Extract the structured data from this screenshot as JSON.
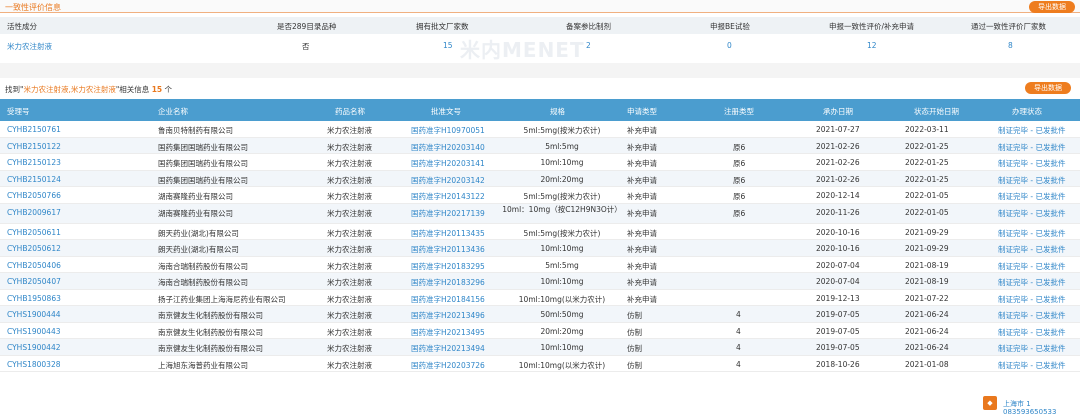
{
  "section_title": "一致性评价信息",
  "export_label": "导出数据",
  "summary": {
    "headers": [
      "活性成分",
      "是否289目录品种",
      "拥有批文厂家数",
      "备案参比制剂",
      "申报BE试验",
      "申报一致性评价/补充申请",
      "通过一致性评价厂家数"
    ],
    "row": [
      "米力农注射液",
      "否",
      "15",
      "2",
      "0",
      "12",
      "8"
    ]
  },
  "watermark": "米内MENET",
  "found": {
    "prefix": "找到\"",
    "keyword": "米力农注射液,米力农注射液",
    "mid": "\"相关信息",
    "count": "15",
    "suffix": "个"
  },
  "table": {
    "headers": [
      "受理号",
      "企业名称",
      "药品名称",
      "批准文号",
      "规格",
      "申请类型",
      "注册类型",
      "承办日期",
      "状态开始日期",
      "办理状态"
    ],
    "rows": [
      [
        "CYHB2150761",
        "鲁南贝特制药有限公司",
        "米力农注射液",
        "国药准字H10970051",
        "5ml:5mg(按米力农计)",
        "补充申请",
        "",
        "2021-07-27",
        "2022-03-11",
        "制证完毕 - 已发批件"
      ],
      [
        "CYHB2150122",
        "国药集团国瑞药业有限公司",
        "米力农注射液",
        "国药准字H20203140",
        "5ml:5mg",
        "补充申请",
        "原6",
        "2021-02-26",
        "2022-01-25",
        "制证完毕 - 已发批件"
      ],
      [
        "CYHB2150123",
        "国药集团国瑞药业有限公司",
        "米力农注射液",
        "国药准字H20203141",
        "10ml:10mg",
        "补充申请",
        "原6",
        "2021-02-26",
        "2022-01-25",
        "制证完毕 - 已发批件"
      ],
      [
        "CYHB2150124",
        "国药集团国瑞药业有限公司",
        "米力农注射液",
        "国药准字H20203142",
        "20ml:20mg",
        "补充申请",
        "原6",
        "2021-02-26",
        "2022-01-25",
        "制证完毕 - 已发批件"
      ],
      [
        "CYHB2050766",
        "湖南赛隆药业有限公司",
        "米力农注射液",
        "国药准字H20143122",
        "5ml:5mg(按米力农计)",
        "补充申请",
        "原6",
        "2020-12-14",
        "2022-01-05",
        "制证完毕 - 已发批件"
      ],
      [
        "CYHB2009617",
        "湖南赛隆药业有限公司",
        "米力农注射液",
        "国药准字H20217139",
        "10ml：10mg（按C12H9N3O计）",
        "补充申请",
        "原6",
        "2020-11-26",
        "2022-01-05",
        "制证完毕 - 已发批件"
      ],
      [
        "CYHB2050611",
        "朗天药业(湖北)有限公司",
        "米力农注射液",
        "国药准字H20113435",
        "5ml:5mg(按米力农计)",
        "补充申请",
        "",
        "2020-10-16",
        "2021-09-29",
        "制证完毕 - 已发批件"
      ],
      [
        "CYHB2050612",
        "朗天药业(湖北)有限公司",
        "米力农注射液",
        "国药准字H20113436",
        "10ml:10mg",
        "补充申请",
        "",
        "2020-10-16",
        "2021-09-29",
        "制证完毕 - 已发批件"
      ],
      [
        "CYHB2050406",
        "海南合瑞制药股份有限公司",
        "米力农注射液",
        "国药准字H20183295",
        "5ml:5mg",
        "补充申请",
        "",
        "2020-07-04",
        "2021-08-19",
        "制证完毕 - 已发批件"
      ],
      [
        "CYHB2050407",
        "海南合瑞制药股份有限公司",
        "米力农注射液",
        "国药准字H20183296",
        "10ml:10mg",
        "补充申请",
        "",
        "2020-07-04",
        "2021-08-19",
        "制证完毕 - 已发批件"
      ],
      [
        "CYHB1950863",
        "扬子江药业集团上海海尼药业有限公司",
        "米力农注射液",
        "国药准字H20184156",
        "10ml:10mg(以米力农计)",
        "补充申请",
        "",
        "2019-12-13",
        "2021-07-22",
        "制证完毕 - 已发批件"
      ],
      [
        "CYHS1900444",
        "南京健友生化制药股份有限公司",
        "米力农注射液",
        "国药准字H20213496",
        "50ml:50mg",
        "仿制",
        "4",
        "2019-07-05",
        "2021-06-24",
        "制证完毕 - 已发批件"
      ],
      [
        "CYHS1900443",
        "南京健友生化制药股份有限公司",
        "米力农注射液",
        "国药准字H20213495",
        "20ml:20mg",
        "仿制",
        "4",
        "2019-07-05",
        "2021-06-24",
        "制证完毕 - 已发批件"
      ],
      [
        "CYHS1900442",
        "南京健友生化制药股份有限公司",
        "米力农注射液",
        "国药准字H20213494",
        "10ml:10mg",
        "仿制",
        "4",
        "2019-07-05",
        "2021-06-24",
        "制证完毕 - 已发批件"
      ],
      [
        "CYHS1800328",
        "上海旭东海普药业有限公司",
        "米力农注射液",
        "国药准字H20203726",
        "10ml:10mg(以米力农计)",
        "仿制",
        "4",
        "2018-10-26",
        "2021-01-08",
        "制证完毕 - 已发批件"
      ]
    ]
  },
  "footer": {
    "line1": "上海市 1",
    "line2": "083593650533"
  }
}
